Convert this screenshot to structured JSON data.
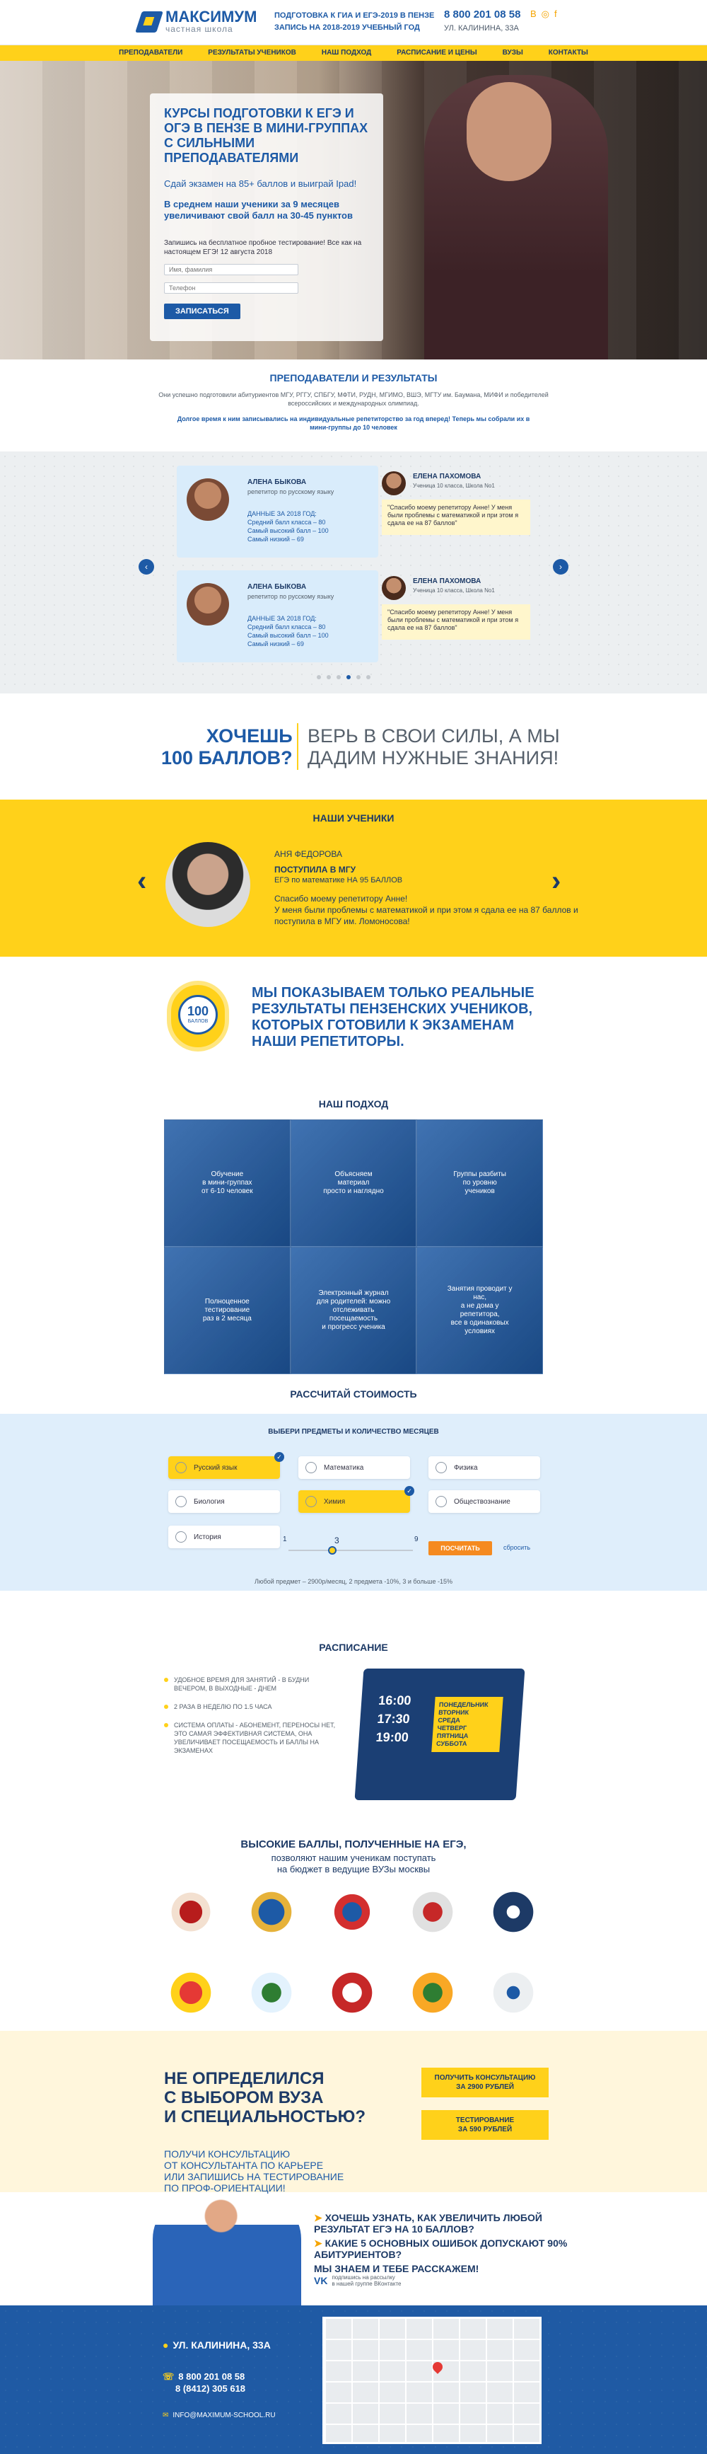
{
  "header": {
    "logo_name": "МАКСИМУМ",
    "logo_sub": "частная школа",
    "tagline1": "ПОДГОТОВКА К ГИА И ЕГЭ-2019 В ПЕНЗЕ",
    "tagline2": "ЗАПИСЬ НА 2018-2019 УЧЕБНЫЙ ГОД",
    "phone": "8 800 201 08 58",
    "address": "УЛ. КАЛИНИНА, 33А",
    "social_icons": [
      "vk-icon",
      "instagram-icon",
      "facebook-icon"
    ]
  },
  "nav": [
    "ПРЕПОДАВАТЕЛИ",
    "РЕЗУЛЬТАТЫ УЧЕНИКОВ",
    "НАШ ПОДХОД",
    "РАСПИСАНИЕ И ЦЕНЫ",
    "ВУЗЫ",
    "КОНТАКТЫ"
  ],
  "hero": {
    "title": "КУРСЫ ПОДГОТОВКИ К ЕГЭ И ОГЭ В ПЕНЗЕ В МИНИ-ГРУППАХ С СИЛЬНЫМИ ПРЕПОДАВАТЕЛЯМИ",
    "promo": "Сдай экзамен на 85+ баллов и выиграй Ipad!",
    "avg": "В среднем наши ученики за 9 месяцев увеличивают свой балл на 30-45 пунктов",
    "note": "Запишись на бесплатное пробное тестирование! Все как на настоящем ЕГЭ! 12 августа 2018",
    "name_placeholder": "Имя, фамилия",
    "phone_placeholder": "Телефон",
    "button": "ЗАПИСАТЬСЯ"
  },
  "teachers": {
    "title": "ПРЕПОДАВАТЕЛИ И РЕЗУЛЬТАТЫ",
    "text": "Они успешно подготовили абитуриентов МГУ, РГГУ, СПБГУ, МФТИ, РУДН, МГИМО, ВШЭ, МГТУ им. Баумана, МИФИ и победителей всероссийских и международных олимпиад.",
    "text2": "Долгое время к ним записывались на индивидуальные репетиторство за год вперед! Теперь мы собрали их в мини-группы до 10 человек",
    "cards": [
      {
        "teacher": "АЛЕНА БЫКОВА",
        "role": "репетитор по русскому языку",
        "data": "ДАННЫЕ ЗА 2018 ГОД:\nСредний балл класса – 80\nСамый высокий балл – 100\nСамый низкий – 69",
        "student": "ЕЛЕНА ПАХОМОВА",
        "info": "Ученица 10 класса, Школа No1",
        "quote": "\"Спасибо моему репетитору Анне! У меня были проблемы с математикой и при этом я сдала ее на 87 баллов\""
      },
      {
        "teacher": "АЛЕНА БЫКОВА",
        "role": "репетитор по русскому языку",
        "data": "ДАННЫЕ ЗА 2018 ГОД:\nСредний балл класса – 80\nСамый высокий балл – 100\nСамый низкий – 69",
        "student": "ЕЛЕНА ПАХОМОВА",
        "info": "Ученица 10 класса, Школа No1",
        "quote": "\"Спасибо моему репетитору Анне! У меня были проблемы с математикой и при этом я сдала ее на 87 баллов\""
      }
    ],
    "active_dot": 3
  },
  "want": {
    "left": "ХОЧЕШЬ\n100 БАЛЛОВ?",
    "right": "ВЕРЬ В СВОИ СИЛЫ, А МЫ\nДАДИМ НУЖНЫЕ ЗНАНИЯ!"
  },
  "students": {
    "title": "НАШИ УЧЕНИКИ",
    "name": "АНЯ ФЕДОРОВА",
    "achievement": "ПОСТУПИЛА В МГУ",
    "detail": "ЕГЭ по математике НА 95 БАЛЛОВ",
    "quote": "Спасибо моему репетитору Анне!\nУ меня были проблемы с математикой и при этом я сдала ее на 87 баллов и поступила в МГУ им. Ломоносова!"
  },
  "real": {
    "badge_num": "100",
    "badge_text": "БАЛЛОВ",
    "text": "МЫ ПОКАЗЫВАЕМ ТОЛЬКО РЕАЛЬНЫЕ РЕЗУЛЬТАТЫ ПЕНЗЕНСКИХ УЧЕНИКОВ, КОТОРЫХ ГОТОВИЛИ К ЭКЗАМЕНАМ НАШИ РЕПЕТИТОРЫ."
  },
  "approach": {
    "title": "НАШ ПОДХОД",
    "cells": [
      "Обучение\nв мини-группах\nот 6-10 человек",
      "Объясняем\nматериал\nпросто и наглядно",
      "Группы разбиты\nпо уровню\nучеников",
      "Полноценное\nтестирование\nраз в 2 месяца",
      "Электронный журнал\nдля родителей: можно\nотслеживать посещаемость\nи прогресс ученика",
      "Занятия проводит у нас,\nа не дома у репетитора,\nвсе в одинаковых\nусловиях"
    ]
  },
  "price": {
    "title": "РАССЧИТАЙ СТОИМОСТЬ",
    "subtitle": "ВЫБЕРИ ПРЕДМЕТЫ И КОЛИЧЕСТВО МЕСЯЦЕВ",
    "subjects": [
      {
        "label": "Русский язык",
        "on": true
      },
      {
        "label": "Математика",
        "on": false
      },
      {
        "label": "Физика",
        "on": false
      },
      {
        "label": "Биология",
        "on": false
      },
      {
        "label": "Химия",
        "on": true
      },
      {
        "label": "Обществознание",
        "on": false
      },
      {
        "label": "История",
        "on": false
      }
    ],
    "months_min": "1",
    "months_value": "3",
    "months_max": "9",
    "months_fraction": 0.35,
    "calc": "ПОСЧИТАТЬ",
    "reset": "сбросить",
    "foot": "Любой предмет – 2900р/месяц, 2 предмета -10%, 3 и больше -15%"
  },
  "schedule": {
    "title": "РАСПИСАНИЕ",
    "items": [
      "УДОБНОЕ ВРЕМЯ ДЛЯ ЗАНЯТИЙ - В БУДНИ ВЕЧЕРОМ, В ВЫХОДНЫЕ - ДНЕМ",
      "2 РАЗА В НЕДЕЛЮ ПО 1.5 ЧАСА",
      "СИСТЕМА ОПЛАТЫ - АБОНЕМЕНТ, ПЕРЕНОСЫ НЕТ, ЭТО САМАЯ ЭФФЕКТИВНАЯ СИСТЕМА, ОНА УВЕЛИЧИВАЕТ ПОСЕЩАЕМОСТЬ И БАЛЛЫ НА ЭКЗАМЕНАХ"
    ],
    "times": "16:00\n17:30\n19:00",
    "days": "ПОНЕДЕЛЬНИК\nВТОРНИК\nСРЕДА\nЧЕТВЕРГ\nПЯТНИЦА\nСУББОТА"
  },
  "unis": {
    "title": "ВЫСОКИЕ БАЛЛЫ, ПОЛУЧЕННЫЕ НА ЕГЭ,",
    "subtitle": "позволяют нашим ученикам поступать\nна бюджет в ведущие ВУЗы москвы"
  },
  "undec": {
    "headline": "НЕ ОПРЕДЕЛИЛСЯ\nС ВЫБОРОМ ВУЗА\nИ СПЕЦИАЛЬНОСТЬЮ?",
    "text": "ПОЛУЧИ КОНСУЛЬТАЦИЮ\nОТ КОНСУЛЬТАНТА ПО КАРЬЕРЕ\nИЛИ ЗАПИШИСЬ НА ТЕСТИРОВАНИЕ\nПО ПРОФ-ОРИЕНТАЦИИ!",
    "btn1": "ПОЛУЧИТЬ КОНСУЛЬТАЦИЮ\nЗА 2900 РУБЛЕЙ",
    "btn2": "ТЕСТИРОВАНИЕ\nЗА 590 РУБЛЕЙ"
  },
  "know": {
    "l1": "ХОЧЕШЬ УЗНАТЬ, КАК УВЕЛИЧИТЬ ЛЮБОЙ РЕЗУЛЬТАТ ЕГЭ НА 10 БАЛЛОВ?",
    "l2": "КАКИЕ 5 ОСНОВНЫХ ОШИБОК ДОПУСКАЮТ 90% АБИТУРИЕНТОВ?",
    "l3": "МЫ ЗНАЕМ И ТЕБЕ РАССКАЖЕМ!",
    "vk": "подпишись на рассылку\nв нашей группе ВКонтакте"
  },
  "footer": {
    "address": "УЛ. КАЛИНИНА, 33А",
    "phones": "8 800 201 08 58\n8 (8412) 305 618",
    "email": "INFO@MAXIMUM-SCHOOL.RU"
  }
}
